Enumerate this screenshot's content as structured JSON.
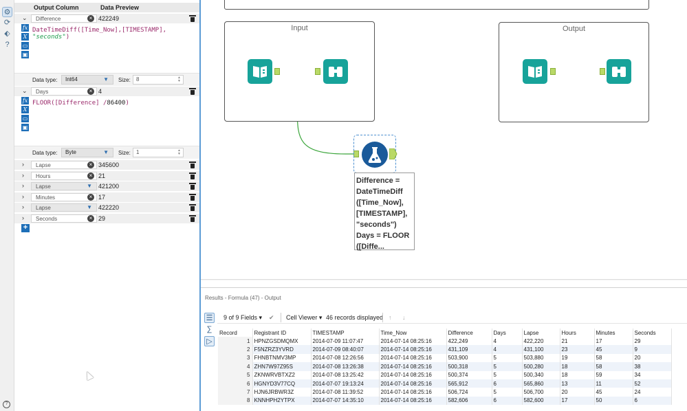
{
  "config": {
    "col_output": "Output Column",
    "col_preview": "Data Preview",
    "expressions": [
      {
        "field": "Difference",
        "preview": "422249",
        "expanded": true,
        "formula_fn": "DateTimeDiff([Time_Now],[TIMESTAMP], ",
        "formula_str": "\"seconds\"",
        "formula_end": ")",
        "type_label": "Data type:",
        "type": "Int64",
        "size_label": "Size:",
        "size": "8"
      },
      {
        "field": "Days",
        "preview": "4",
        "expanded": true,
        "formula_fn": "FLOOR([Difference] /",
        "formula_num": "86400",
        "formula_end": ")",
        "type_label": "Data type:",
        "type": "Byte",
        "size_label": "Size:",
        "size": "1"
      }
    ],
    "collapsed": [
      {
        "field": "Lapse",
        "preview": "345600",
        "kind": "text"
      },
      {
        "field": "Hours",
        "preview": "21",
        "kind": "text"
      },
      {
        "field": "Lapse",
        "preview": "421200",
        "kind": "select"
      },
      {
        "field": "Minutes",
        "preview": "17",
        "kind": "text"
      },
      {
        "field": "Lapse",
        "preview": "422220",
        "kind": "select"
      },
      {
        "field": "Seconds",
        "preview": "29",
        "kind": "text"
      }
    ],
    "add_label": "+"
  },
  "canvas": {
    "input_title": "Input",
    "output_title": "Output",
    "annotation": "Difference =\nDateTimeDiff\n([Time_Now],\n[TIMESTAMP],\n\"seconds\")\nDays = FLOOR\n([Diffe...",
    "scroll_left": "‹"
  },
  "results": {
    "title": "Results - Formula (47) - Output",
    "fields_selector": "9 of 9 Fields",
    "viewer": "Cell Viewer",
    "records_displayed": "46 records displayed",
    "columns": [
      "Record",
      "Registrant ID",
      "TIMESTAMP",
      "Time_Now",
      "Difference",
      "Days",
      "Lapse",
      "Hours",
      "Minutes",
      "Seconds"
    ],
    "rows": [
      [
        "1",
        "HPNZGSDMQMX",
        "2014-07-09 11:07:47",
        "2014-07-14 08:25:16",
        "422,249",
        "4",
        "422,220",
        "21",
        "17",
        "29"
      ],
      [
        "2",
        "F5NZRZ3YVRD",
        "2014-07-09 08:40:07",
        "2014-07-14 08:25:16",
        "431,109",
        "4",
        "431,100",
        "23",
        "45",
        "9"
      ],
      [
        "3",
        "FHNBTNMV3MP",
        "2014-07-08 12:26:56",
        "2014-07-14 08:25:16",
        "503,900",
        "5",
        "503,880",
        "19",
        "58",
        "20"
      ],
      [
        "4",
        "ZHN7W97Z95S",
        "2014-07-08 13:26:38",
        "2014-07-14 08:25:16",
        "500,318",
        "5",
        "500,280",
        "18",
        "58",
        "38"
      ],
      [
        "5",
        "ZKNWRVBTXZ2",
        "2014-07-08 13:25:42",
        "2014-07-14 08:25:16",
        "500,374",
        "5",
        "500,340",
        "18",
        "59",
        "34"
      ],
      [
        "6",
        "HGNYD3V77CQ",
        "2014-07-07 19:13:24",
        "2014-07-14 08:25:16",
        "565,912",
        "6",
        "565,860",
        "13",
        "11",
        "52"
      ],
      [
        "7",
        "HJN6JRBWR3Z",
        "2014-07-08 11:39:52",
        "2014-07-14 08:25:16",
        "506,724",
        "5",
        "506,700",
        "20",
        "45",
        "24"
      ],
      [
        "8",
        "KNNHPH2YTPX",
        "2014-07-07 14:35:10",
        "2014-07-14 08:25:16",
        "582,606",
        "6",
        "582,600",
        "17",
        "50",
        "6"
      ]
    ]
  },
  "colors": {
    "accent": "#1e6fb8",
    "tool_teal": "#17a39a",
    "connector": "#3aa53a",
    "anchor": "#b9d967"
  }
}
